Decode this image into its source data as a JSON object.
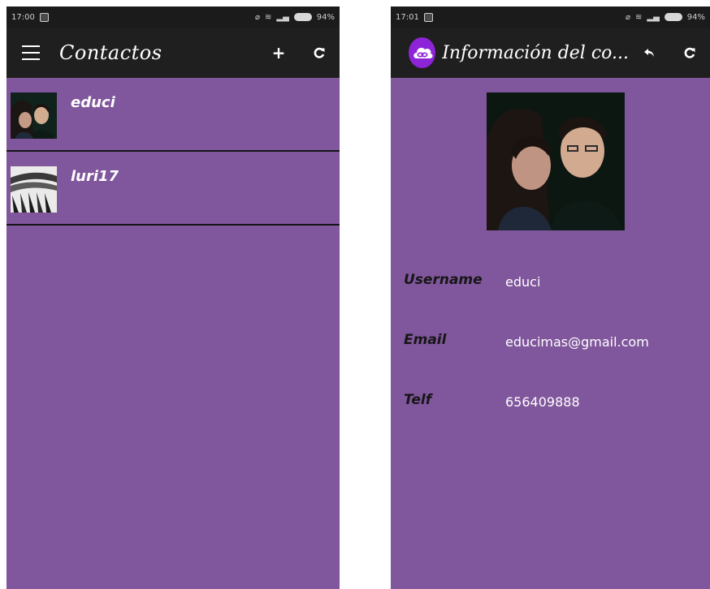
{
  "left_screen": {
    "status_bar": {
      "time": "17:00",
      "battery_pct": "94%"
    },
    "toolbar": {
      "title": "Contactos",
      "menu_icon": "hamburger-menu-icon",
      "add_label": "+",
      "refresh_icon": "refresh-icon"
    },
    "contacts": [
      {
        "name": "educi",
        "thumb_icon": "couple-photo"
      },
      {
        "name": "luri17",
        "thumb_icon": "stairs-photo"
      }
    ]
  },
  "right_screen": {
    "status_bar": {
      "time": "17:01",
      "battery_pct": "94%"
    },
    "toolbar": {
      "title": "Información del co...",
      "logo_icon": "cloud-link-logo-icon",
      "back_icon": "reply-arrow-icon",
      "refresh_icon": "refresh-icon"
    },
    "details": {
      "username_label": "Username",
      "username_value": "educi",
      "email_label": "Email",
      "email_value": "educimas@gmail.com",
      "phone_label": "Telf",
      "phone_value": "656409888"
    }
  },
  "colors": {
    "background": "#80569c",
    "toolbar": "#1f1f1f",
    "status_bar": "#1b1b1b",
    "logo": "#8e24d8",
    "divider": "#141414"
  }
}
